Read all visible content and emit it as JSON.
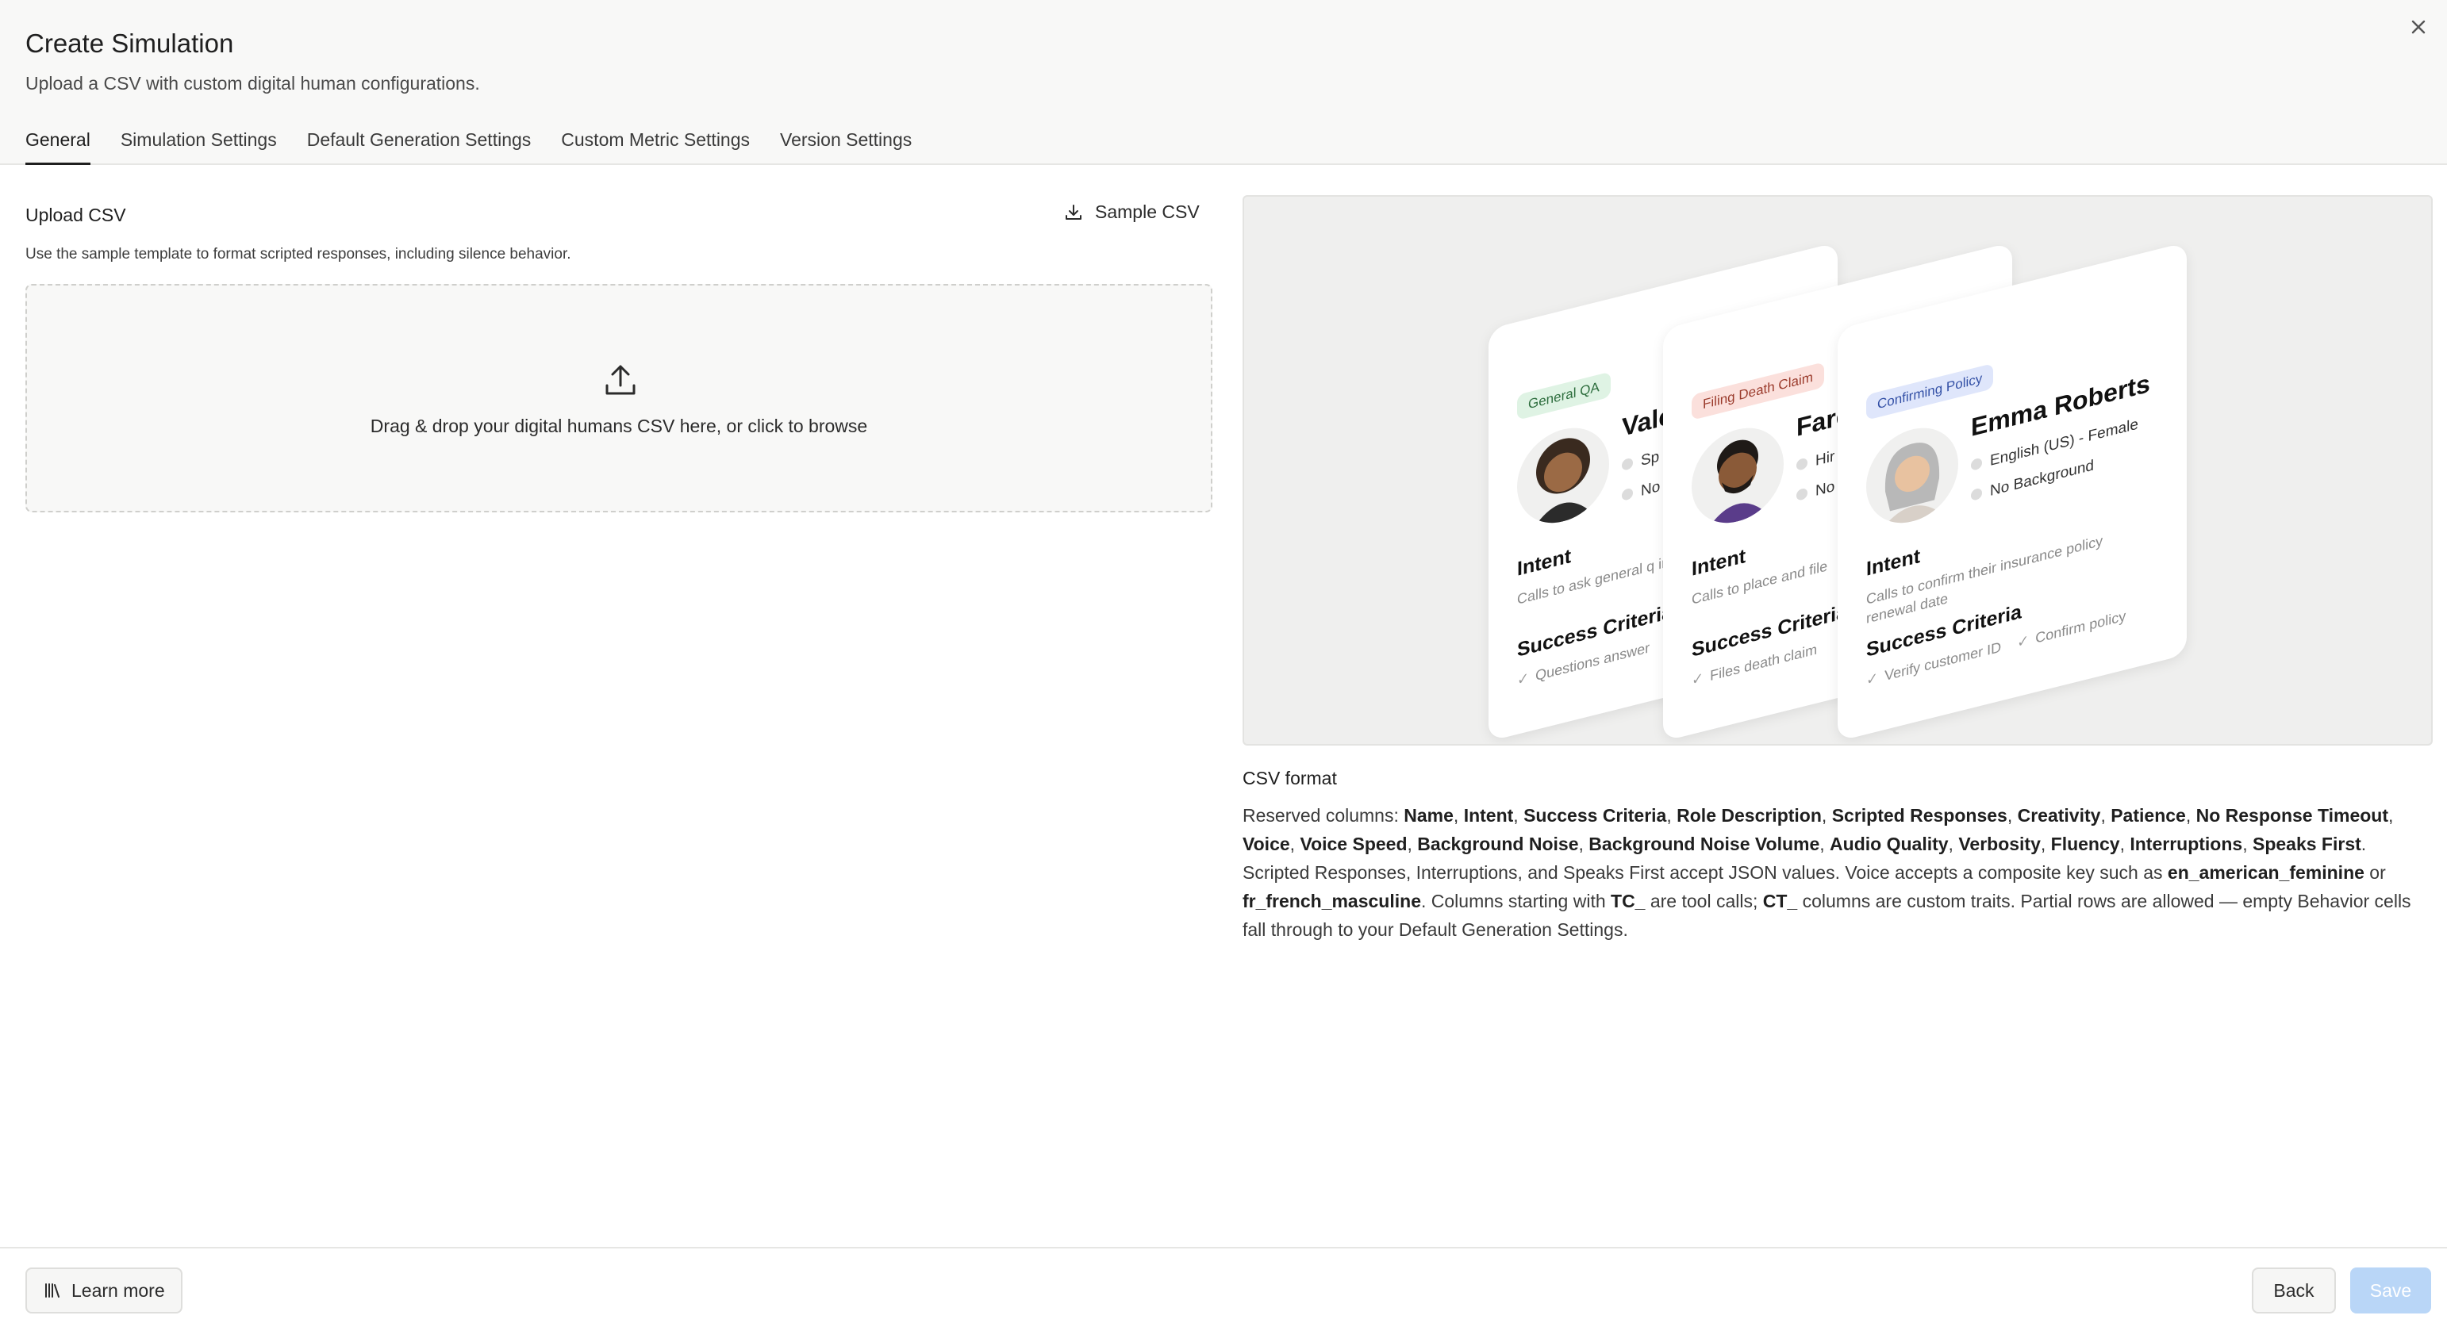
{
  "dialog": {
    "title": "Create Simulation",
    "subtitle": "Upload a CSV with custom digital human configurations."
  },
  "tabs": [
    {
      "label": "General",
      "active": true
    },
    {
      "label": "Simulation Settings",
      "active": false
    },
    {
      "label": "Default Generation Settings",
      "active": false
    },
    {
      "label": "Custom Metric Settings",
      "active": false
    },
    {
      "label": "Version Settings",
      "active": false
    }
  ],
  "upload": {
    "label": "Upload CSV",
    "sample_label": "Sample CSV",
    "help": "Use the sample template to format scripted responses, including silence behavior.",
    "drop_text": "Drag & drop your digital humans CSV here, or click to browse"
  },
  "preview": {
    "cards": [
      {
        "pill": "General QA",
        "name": "Vale",
        "line1": "Sp",
        "line2": "No",
        "intent_heading": "Intent",
        "intent": "Calls to ask general q insurance provider lik",
        "success_heading": "Success Criteria",
        "criteria": [
          "Questions answer"
        ]
      },
      {
        "pill": "Filing Death Claim",
        "name": "Fare",
        "line1": "Hir",
        "line2": "No",
        "intent_heading": "Intent",
        "intent": "Calls to place and file",
        "success_heading": "Success Criteria",
        "criteria": [
          "Files death claim"
        ]
      },
      {
        "pill": "Confirming Policy",
        "name": "Emma Roberts",
        "line1": "English (US) - Female",
        "line2": "No Background",
        "intent_heading": "Intent",
        "intent": "Calls to confirm their insurance policy renewal date",
        "success_heading": "Success Criteria",
        "criteria": [
          "Verify customer ID",
          "Confirm policy"
        ]
      }
    ]
  },
  "csv_format": {
    "title": "CSV format",
    "reserved_prefix": "Reserved columns: ",
    "columns": [
      "Name",
      "Intent",
      "Success Criteria",
      "Role Description",
      "Scripted Responses",
      "Creativity",
      "Patience",
      "No Response Timeout",
      "Voice",
      "Voice Speed",
      "Background Noise",
      "Background Noise Volume",
      "Audio Quality",
      "Verbosity",
      "Fluency",
      "Interruptions",
      "Speaks First"
    ],
    "sentence_json": ". Scripted Responses, Interruptions, and Speaks First accept JSON values. Voice accepts a composite key such as ",
    "voice_key_1": "en_american_feminine",
    "or_text": " or ",
    "voice_key_2": "fr_french_masculine",
    "tc_pre": ". Columns starting with ",
    "tc_prefix": "TC_",
    "tc_post": " are tool calls; ",
    "ct_prefix": "CT_",
    "ct_post": " columns are custom traits. Partial rows are allowed — empty Behavior cells fall through to your Default Generation Settings."
  },
  "footer": {
    "learn_more": "Learn more",
    "back": "Back",
    "save": "Save"
  },
  "colors": {
    "accent_disabled": "#b9d6f7",
    "header_bg": "#f8f8f7"
  }
}
